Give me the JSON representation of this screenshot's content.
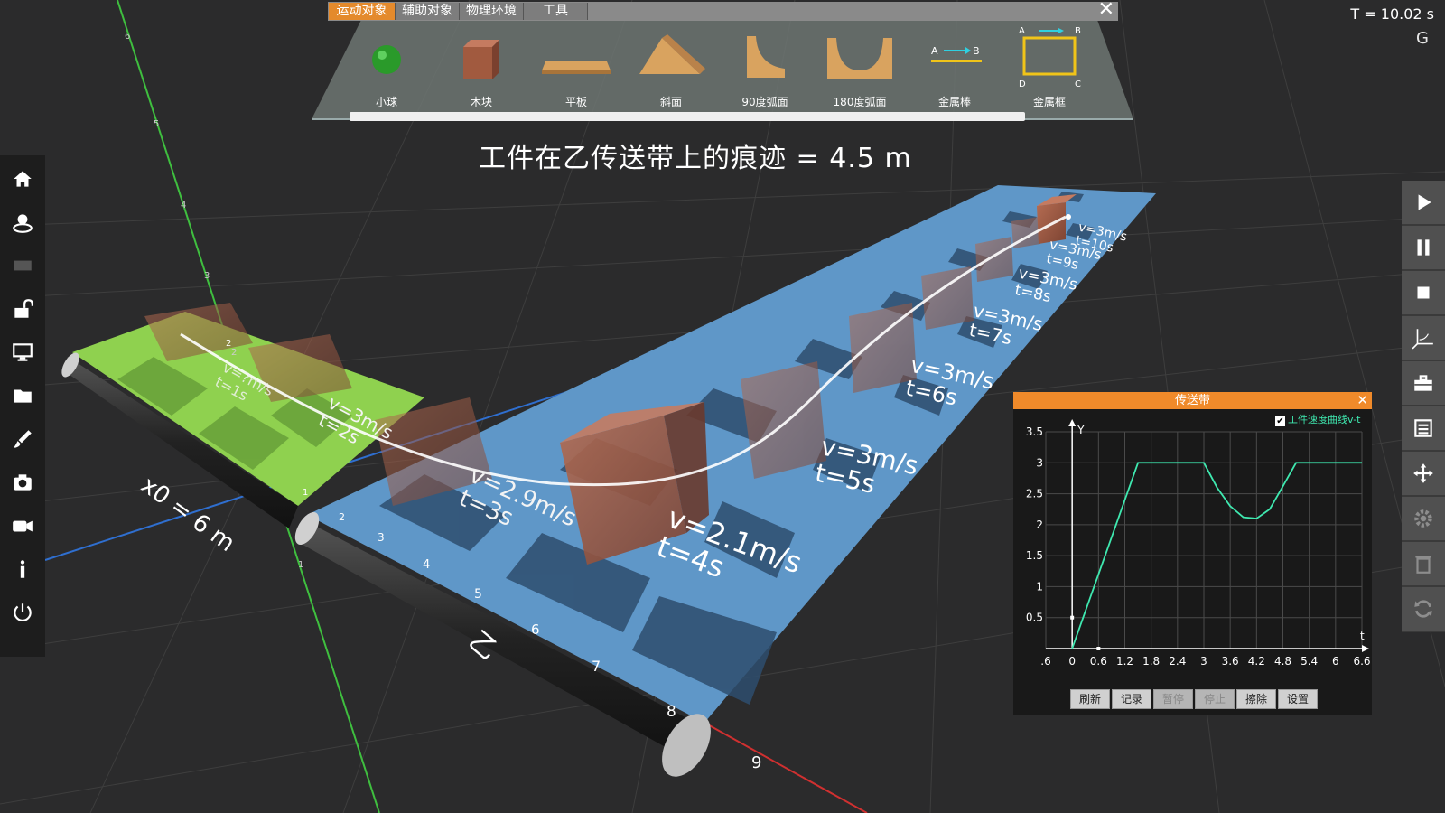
{
  "library": {
    "tabs": [
      "运动对象",
      "辅助对象",
      "物理环境",
      "工具"
    ],
    "active_tab": "运动对象",
    "items": [
      "小球",
      "木块",
      "平板",
      "斜面",
      "90度弧面",
      "180度弧面",
      "金属棒",
      "金属框"
    ],
    "rod_labels": [
      "A",
      "B"
    ],
    "frame_labels": [
      "A",
      "B",
      "C",
      "D"
    ]
  },
  "headline": "工件在乙传送带上的痕迹 = 4.5 m",
  "time_readout": "T = 10.02 s",
  "gravity_label": "G",
  "scene": {
    "belt_a_label": "x0 = 6 m",
    "belt_b_label": "乙",
    "ruler_a_ticks": [
      "1",
      "2"
    ],
    "ruler_b_ticks": [
      "2",
      "3",
      "4",
      "5",
      "6",
      "7",
      "8",
      "9"
    ],
    "axis_ticks": [
      "1",
      "2",
      "3",
      "4",
      "5",
      "6"
    ],
    "block_labels": [
      {
        "v": "v=?m/s",
        "t": "t=1s"
      },
      {
        "v": "v=3m/s",
        "t": "t=2s"
      },
      {
        "v": "v=2.9m/s",
        "t": "t=3s"
      },
      {
        "v": "v=2.1m/s",
        "t": "t=4s"
      },
      {
        "v": "v=3m/s",
        "t": "t=5s"
      },
      {
        "v": "v=3m/s",
        "t": "t=6s"
      },
      {
        "v": "v=3m/s",
        "t": "t=7s"
      },
      {
        "v": "v=3m/s",
        "t": "t=8s"
      },
      {
        "v": "v=3m/s",
        "t": "t=9s"
      },
      {
        "v": "v=3m/s",
        "t": "t=10s"
      }
    ]
  },
  "chart_window": {
    "title": "传送带",
    "legend": "工件速度曲线v-t",
    "buttons": [
      "刷新",
      "记录",
      "暂停",
      "停止",
      "擦除",
      "设置"
    ],
    "disabled_buttons": [
      "暂停",
      "停止"
    ]
  },
  "chart_data": {
    "type": "line",
    "xlabel": "t",
    "ylabel": "Y",
    "xlim": [
      -0.6,
      6.6
    ],
    "ylim": [
      0,
      3.5
    ],
    "x_ticks": [
      ".6",
      "0",
      "0.6",
      "1.2",
      "1.8",
      "2.4",
      "3",
      "3.6",
      "4.2",
      "4.8",
      "5.4",
      "6",
      "6.6"
    ],
    "y_ticks": [
      "0.5",
      "1",
      "1.5",
      "2",
      "2.5",
      "3",
      "3.5"
    ],
    "grid": true,
    "legend_position": "top-right",
    "series": [
      {
        "name": "工件速度曲线v-t",
        "color": "#3fe9b0",
        "x": [
          0,
          0.3,
          0.6,
          0.9,
          1.2,
          1.5,
          2.4,
          3.0,
          3.3,
          3.6,
          3.9,
          4.2,
          4.5,
          4.8,
          5.1,
          6.0,
          6.6
        ],
        "y": [
          0,
          0.6,
          1.2,
          1.8,
          2.4,
          3.0,
          3.0,
          3.0,
          2.6,
          2.3,
          2.12,
          2.1,
          2.25,
          2.62,
          3.0,
          3.0,
          3.0
        ]
      }
    ]
  },
  "left_toolbar": [
    "home-icon",
    "user-icon",
    "film-icon",
    "unlock-icon",
    "monitor-icon",
    "folder-icon",
    "brush-icon",
    "camera-icon",
    "video-icon",
    "info-icon",
    "power-icon"
  ],
  "right_toolbar": [
    "play-icon",
    "pause-icon",
    "stop-icon",
    "axis-3d-icon",
    "toolbox-icon",
    "list-icon",
    "move-icon",
    "gear-icon",
    "trash-icon",
    "refresh-icon"
  ],
  "colors": {
    "accent": "#f08a2a",
    "curve": "#3fe9b0",
    "belt_blue": "#5f97c8",
    "belt_green": "#8fd14f",
    "block": "#9a5a44"
  }
}
